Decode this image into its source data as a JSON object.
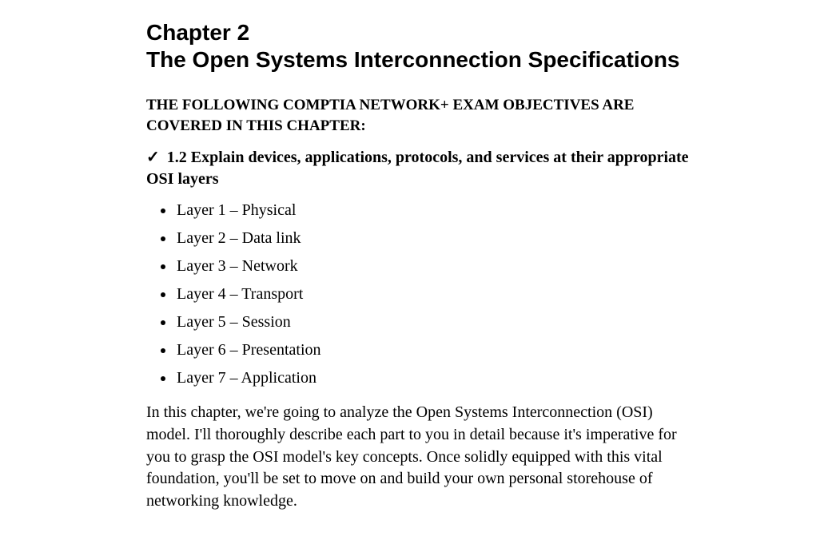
{
  "chapter": {
    "number": "Chapter 2",
    "title": "The Open Systems Interconnection Specifications"
  },
  "objectives_intro": "THE FOLLOWING COMPTIA NETWORK+ EXAM OBJECTIVES ARE COVERED IN THIS CHAPTER:",
  "objective": {
    "check": "✓",
    "text": "1.2 Explain devices, applications, protocols, and services at their appropriate OSI layers"
  },
  "layers": [
    "Layer 1 – Physical",
    "Layer 2 – Data link",
    "Layer 3 – Network",
    "Layer 4 – Transport",
    "Layer 5 – Session",
    "Layer 6 – Presentation",
    "Layer 7 – Application"
  ],
  "intro_paragraph": "In this chapter, we're going to analyze the Open Systems Interconnection (OSI) model. I'll thoroughly describe each part to you in detail because it's imperative for you to grasp the OSI model's key concepts. Once solidly equipped with this vital foundation, you'll be set to move on and build your own personal storehouse of networking knowledge."
}
